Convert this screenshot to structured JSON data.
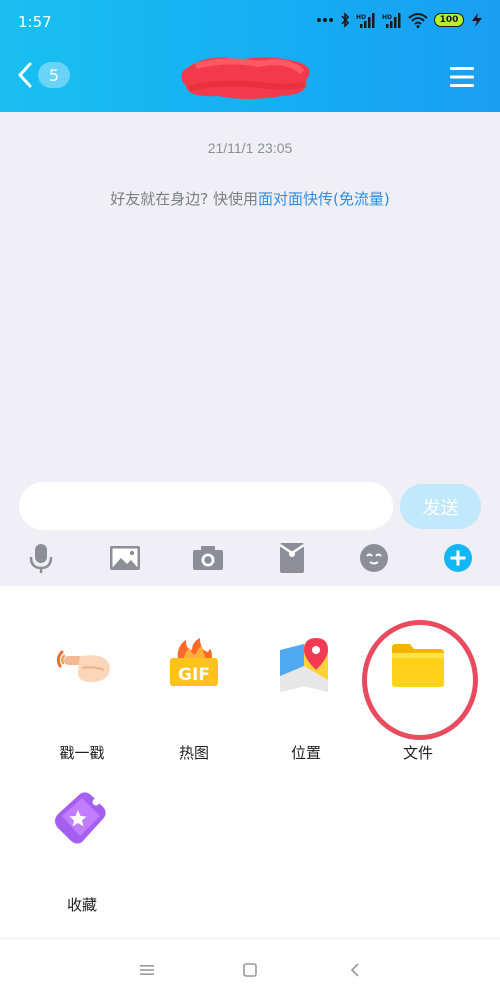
{
  "status_bar": {
    "time": "1:57",
    "battery": "100"
  },
  "header": {
    "unread_count": "5"
  },
  "chat": {
    "timestamp": "21/11/1 23:05",
    "tip_prefix": "好友就在身边? 快使用",
    "tip_link": "面对面快传(免流量)"
  },
  "input": {
    "value": "",
    "placeholder": ""
  },
  "send_label": "发送",
  "toolbar": [
    {
      "icon": "microphone-icon"
    },
    {
      "icon": "image-icon"
    },
    {
      "icon": "camera-icon"
    },
    {
      "icon": "red-packet-icon"
    },
    {
      "icon": "emoji-icon"
    },
    {
      "icon": "plus-icon"
    }
  ],
  "panel": {
    "items": [
      {
        "label": "戳一戳",
        "icon": "poke-icon"
      },
      {
        "label": "热图",
        "icon": "gif-icon",
        "icon_text": "GIF"
      },
      {
        "label": "位置",
        "icon": "location-icon"
      },
      {
        "label": "文件",
        "icon": "folder-icon"
      },
      {
        "label": "收藏",
        "icon": "favorites-icon"
      }
    ]
  },
  "colors": {
    "header_start": "#19c0f1",
    "header_end": "#1a9ef1",
    "chat_bg": "#efeff5",
    "link": "#2d8ee6",
    "send_button": "#c1e8fb",
    "toolbar_icon": "#8e8e98",
    "plus_accent": "#12b7f5",
    "highlight_circle": "#e84a5f"
  }
}
